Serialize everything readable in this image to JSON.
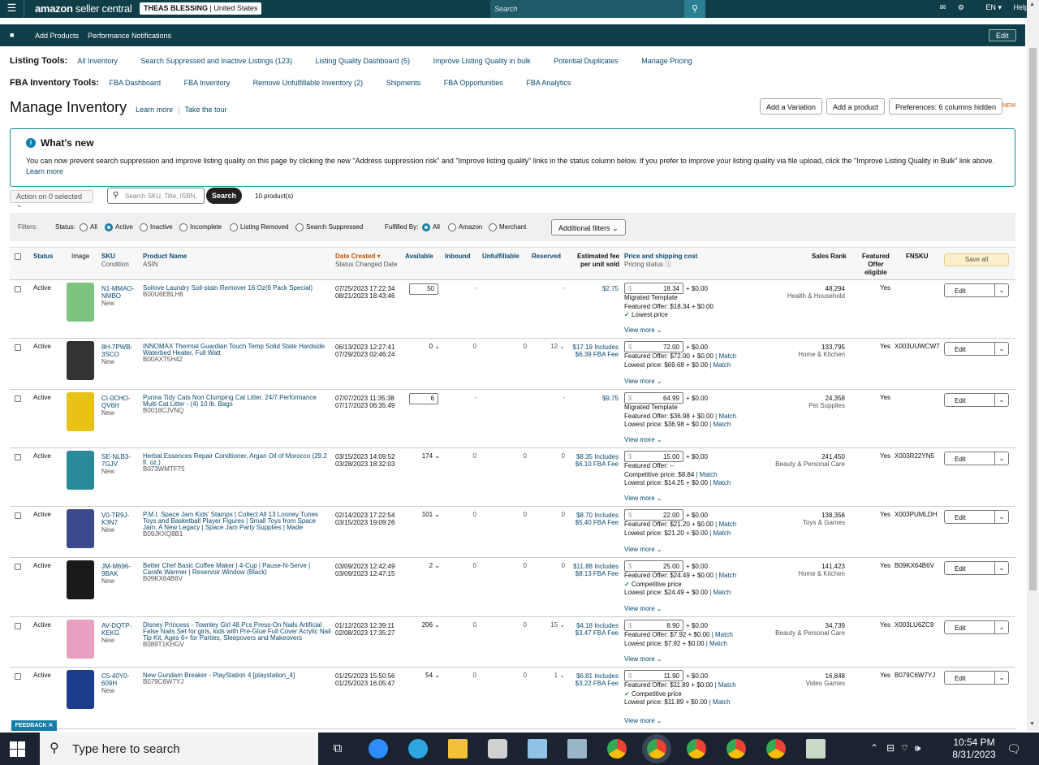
{
  "header": {
    "logo_bold": "amazon",
    "logo_rest": " seller central",
    "account_bold": "THEAS BLESSING",
    "account_rest": " | United States",
    "search_placeholder": "Search",
    "lang": "EN",
    "help": "Help"
  },
  "subbar": {
    "add_products": "Add Products",
    "performance": "Performance Notifications",
    "edit": "Edit"
  },
  "listing_tools": {
    "heading": "Listing Tools:",
    "items": [
      "All Inventory",
      "Search Suppressed and Inactive Listings (123)",
      "Listing Quality Dashboard (5)",
      "Improve Listing Quality in bulk",
      "Potential Duplicates",
      "Manage Pricing"
    ]
  },
  "fba_tools": {
    "heading": "FBA Inventory Tools:",
    "items": [
      "FBA Dashboard",
      "FBA Inventory",
      "Remove Unfulfillable Inventory (2)",
      "Shipments",
      "FBA Opportunities",
      "FBA Analytics"
    ]
  },
  "page": {
    "title": "Manage Inventory",
    "learn_more": "Learn more",
    "tour": "Take the tour",
    "add_variation": "Add a Variation",
    "add_product": "Add a product",
    "preferences": "Preferences: 6 columns hidden",
    "new_badge": "NEW"
  },
  "whats_new": {
    "title": "What's new",
    "body": "You can now prevent search suppression and improve listing quality on this page by clicking the new \"Address suppression risk\" and \"Improve listing quality\" links in the status column below. If you prefer to improve your listing quality via file upload, click the \"Improve Listing Quality in Bulk\" link above.",
    "link": "Learn more"
  },
  "actions": {
    "action_select": "Action on 0 selected",
    "search_placeholder": "Search SKU, Title, ISBN,",
    "search_button": "Search",
    "count": "10 product(s)"
  },
  "filters": {
    "label": "Filters:",
    "status_label": "Status:",
    "status_options": [
      "All",
      "Active",
      "Inactive",
      "Incomplete",
      "Listing Removed",
      "Search Suppressed"
    ],
    "status_selected": "Active",
    "fulfilled_label": "Fulfilled By:",
    "fulfilled_options": [
      "All",
      "Amazon",
      "Merchant"
    ],
    "fulfilled_selected": "All",
    "additional": "Additional filters"
  },
  "columns": {
    "status": "Status",
    "image": "Image",
    "sku": "SKU",
    "condition": "Condition",
    "product_name": "Product Name",
    "asin": "ASIN",
    "date_created": "Date Created",
    "status_changed": "Status Changed Date",
    "available": "Available",
    "inbound": "Inbound",
    "unfulfillable": "Unfulfillable",
    "reserved": "Reserved",
    "fee1": "Estimated fee",
    "fee2": "per unit sold",
    "price": "Price and shipping cost",
    "pricing_status": "Pricing status",
    "sales_rank": "Sales Rank",
    "featured1": "Featured",
    "featured2": "Offer",
    "featured3": "eligible",
    "fnsku": "FNSKU",
    "save_all": "Save all"
  },
  "rows": [
    {
      "status": "Active",
      "sku1": "N1-MMAO-",
      "sku2": "NMBO",
      "cond": "New",
      "name": "Soilove Laundry Soil-stain Remover 16 Oz(6 Pack Special)",
      "asin": "B00U6EBLH6",
      "date1": "07/25/2023 17:22:34",
      "date2": "08/21/2023 18:43:46",
      "avail": "50",
      "inbound": "-",
      "unf": "",
      "res": "-",
      "fee1": "$2.75",
      "fee2": "",
      "price": "18.34",
      "ship": "+ $0.00",
      "p1": "Migrated Template",
      "p2": "Featured Offer: $18.34 + $0.00",
      "p3": "Lowest price",
      "p4": "",
      "view": "View more",
      "rank": "48,294",
      "cat": "Health & Household",
      "feat": "Yes",
      "fnsku": "",
      "edit": "Edit",
      "img": "#7cc47f"
    },
    {
      "status": "Active",
      "sku1": "8H-7PWB-",
      "sku2": "3SCO",
      "cond": "New",
      "name": "INNOMAX Thermal Guardian Touch Temp Solid State Hardside Waterbed Heater, Full Watt",
      "asin": "B00AXT5H42",
      "date1": "06/13/2023 12:27:41",
      "date2": "07/29/2023 02:46:24",
      "avail": "0",
      "inbound": "0",
      "unf": "0",
      "res": "12",
      "fee1": "$17.19 Includes",
      "fee2": "$6.39 FBA Fee",
      "price": "72.00",
      "ship": "+ $0.00",
      "p1": "Featured Offer: $72.00 + $0.00",
      "p2": "Lowest price: $69.68 + $0.00",
      "p3": "",
      "p4": "",
      "view": "View more",
      "rank": "133,795",
      "cat": "Home & Kitchen",
      "feat": "Yes",
      "fnsku": "X003UUWCW7",
      "edit": "Edit",
      "img": "#333"
    },
    {
      "status": "Active",
      "sku1": "CI-0CHO-",
      "sku2": "QV6H",
      "cond": "New",
      "name": "Purina Tidy Cats Non Clumping Cat Litter, 24/7 Performance Multi Cat Litter - (4) 10 lb. Bags",
      "asin": "B0018CJVNQ",
      "date1": "07/07/2023 11:35:38",
      "date2": "07/17/2023 06:35:49",
      "avail": "6",
      "inbound": "-",
      "unf": "",
      "res": "-",
      "fee1": "$9.75",
      "fee2": "",
      "price": "64.99",
      "ship": "+ $0.00",
      "p1": "Migrated Template",
      "p2": "Featured Offer: $36.98 + $0.00",
      "p3": "Lowest price: $36.98 + $0.00",
      "p4": "",
      "view": "View more",
      "rank": "24,358",
      "cat": "Pet Supplies",
      "feat": "Yes",
      "fnsku": "",
      "edit": "Edit",
      "img": "#e8c218"
    },
    {
      "status": "Active",
      "sku1": "SE-NLB3-",
      "sku2": "7GJV",
      "cond": "New",
      "name": "Herbal Essences Repair Condtioner, Argan Oil of Morocco (29.2 fl. oz.)",
      "asin": "B073WMTF75",
      "date1": "03/15/2023 14:09:52",
      "date2": "03/28/2023 18:32:03",
      "avail": "174",
      "inbound": "0",
      "unf": "0",
      "res": "0",
      "fee1": "$8.35 Includes",
      "fee2": "$6.10 FBA Fee",
      "price": "15.00",
      "ship": "+ $0.00",
      "p1": "Featured Offer: --",
      "p2": "Competitive price: $8.84",
      "p3": "Lowest price: $14.25 + $0.00",
      "p4": "",
      "view": "View more",
      "rank": "241,450",
      "cat": "Beauty & Personal Care",
      "feat": "Yes",
      "fnsku": "X003R22YN5",
      "edit": "Edit",
      "img": "#2a8a9a"
    },
    {
      "status": "Active",
      "sku1": "V0-TR9J-",
      "sku2": "K3N7",
      "cond": "New",
      "name": "P.M.I. Space Jam Kids' Stamps | Collect All 13 Looney Tunes Toys and Basketball Player Figures | Small Toys from Space Jam: A New Legacy | Space Jam Party Supplies | Made",
      "asin": "B09JKXQ8B1",
      "date1": "02/14/2023 17:22:54",
      "date2": "03/15/2023 19:09:26",
      "avail": "101",
      "inbound": "0",
      "unf": "0",
      "res": "0",
      "fee1": "$8.70 Includes",
      "fee2": "$5.40 FBA Fee",
      "price": "22.00",
      "ship": "+ $0.00",
      "p1": "Featured Offer: $21.20 + $0.00",
      "p2": "Lowest price: $21.20 + $0.00",
      "p3": "",
      "p4": "",
      "view": "View more",
      "rank": "138,356",
      "cat": "Toys & Games",
      "feat": "Yes",
      "fnsku": "X003PUMLDH",
      "edit": "Edit",
      "img": "#3a4a8a"
    },
    {
      "status": "Active",
      "sku1": "JM-M696-",
      "sku2": "9BAK",
      "cond": "New",
      "name": "Better Chef Basic Coffee Maker | 4-Cup | Pause-N-Serve | Carafe Warmer | Reservoir Window (Black)",
      "asin": "B09KX64B6V",
      "date1": "03/09/2023 12:42:49",
      "date2": "03/09/2023 12:47:15",
      "avail": "2",
      "inbound": "0",
      "unf": "0",
      "res": "0",
      "fee1": "$11.88 Includes",
      "fee2": "$8.13 FBA Fee",
      "price": "25.00",
      "ship": "+ $0.00",
      "p1": "Featured Offer: $24.49 + $0.00",
      "p2": "Competitive price",
      "p3": "Lowest price: $24.49 + $0.00",
      "p4": "",
      "view": "View more",
      "rank": "141,423",
      "cat": "Home & Kitchen",
      "feat": "Yes",
      "fnsku": "B09KX64B6V",
      "edit": "Edit",
      "img": "#1a1a1a"
    },
    {
      "status": "Active",
      "sku1": "AV-DQTP-",
      "sku2": "KEKG",
      "cond": "New",
      "name": "Disney Princess - Townley Girl 48 Pcs Press-On Nails Artificial False Nails Set for girls, kids with Pre-Glue Full Cover Acrylic Nail Tip Kit, Ages 6+ for Parties, Sleepovers and Makeovers",
      "asin": "B089T1KHGV",
      "date1": "01/12/2023 12:39:11",
      "date2": "02/08/2023 17:35:27",
      "avail": "206",
      "inbound": "0",
      "unf": "0",
      "res": "15",
      "fee1": "$4.18 Includes",
      "fee2": "$3.47 FBA Fee",
      "price": "8.90",
      "ship": "+ $0.00",
      "p1": "Featured Offer: $7.92 + $0.00",
      "p2": "Lowest price: $7.92 + $0.00",
      "p3": "",
      "p4": "",
      "view": "View more",
      "rank": "34,739",
      "cat": "Beauty & Personal Care",
      "feat": "Yes",
      "fnsku": "X003LU6ZC9",
      "edit": "Edit",
      "img": "#e7a0c0"
    },
    {
      "status": "Active",
      "sku1": "C5-40Y0-",
      "sku2": "609H",
      "cond": "New",
      "name": "New Gundam Breaker - PlayStation 4 [playstation_4]",
      "asin": "B079C6W7YJ",
      "date1": "01/25/2023 15:50:56",
      "date2": "01/25/2023 16:05:47",
      "avail": "54",
      "inbound": "0",
      "unf": "0",
      "res": "1",
      "fee1": "$6.81 Includes",
      "fee2": "$3.22 FBA Fee",
      "price": "11.90",
      "ship": "+ $0.00",
      "p1": "Featured Offer: $11.89 + $0.00",
      "p2": "Competitive price",
      "p3": "Lowest price: $11.89 + $0.00",
      "p4": "",
      "view": "View more",
      "rank": "16,848",
      "cat": "Video Games",
      "feat": "Yes",
      "fnsku": "B079C6W7YJ",
      "edit": "Edit",
      "img": "#1c3c8c"
    }
  ],
  "feedback": "FEEDBACK",
  "taskbar": {
    "search": "Type here to search",
    "time": "10:54 PM",
    "date": "8/31/2023"
  }
}
